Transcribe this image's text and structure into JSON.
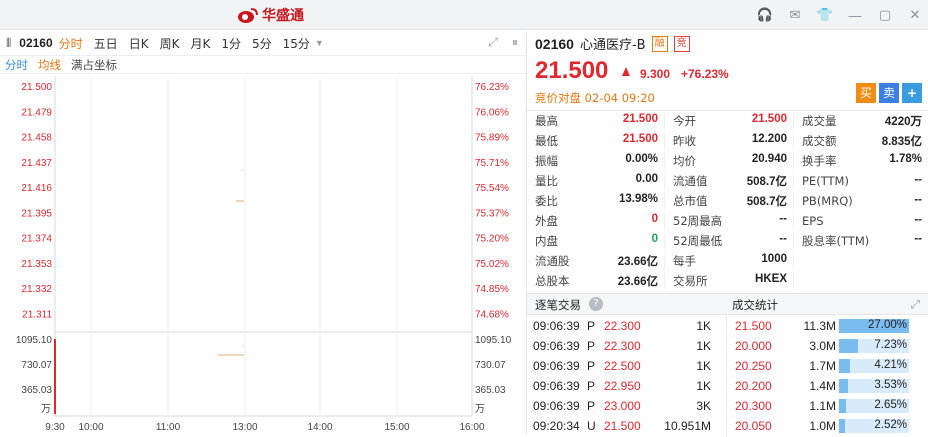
{
  "app": {
    "logo_text": "华盛通"
  },
  "toolbar": {
    "code": "02160",
    "timeframes": [
      "分时",
      "五日",
      "日K",
      "周K",
      "月K",
      "1分",
      "5分",
      "15分"
    ],
    "active_index": 0
  },
  "subtabs": {
    "tab1": "分时",
    "tab2": "均线",
    "tab3": "满占坐标"
  },
  "chart_data": {
    "type": "line",
    "price_ticks": [
      "21.500",
      "21.479",
      "21.458",
      "21.437",
      "21.416",
      "21.395",
      "21.374",
      "21.353",
      "21.332",
      "21.311"
    ],
    "pct_ticks": [
      "76.23%",
      "76.06%",
      "75.89%",
      "75.71%",
      "75.54%",
      "75.37%",
      "75.20%",
      "75.02%",
      "74.85%",
      "74.68%"
    ],
    "volume_ticks": [
      "1095.10",
      "730.07",
      "365.03"
    ],
    "volume_unit": "万",
    "x_ticks": [
      "9:30",
      "10:00",
      "11:00",
      "13:00",
      "14:00",
      "15:00",
      "16:00"
    ],
    "grid": true
  },
  "quote": {
    "code": "02160",
    "name": "心通医疗-B",
    "badge1": "融",
    "badge2": "竞",
    "price": "21.500",
    "change": "9.300",
    "change_pct": "+76.23%",
    "auction": "竞价对盘 02-04 09:20",
    "buy": "买",
    "sell": "卖",
    "add": "+"
  },
  "stats": [
    [
      [
        "最高",
        "21.500",
        "red"
      ],
      [
        "今开",
        "21.500",
        "red"
      ],
      [
        "成交量",
        "4220万",
        ""
      ]
    ],
    [
      [
        "最低",
        "21.500",
        "red"
      ],
      [
        "昨收",
        "12.200",
        ""
      ],
      [
        "成交额",
        "8.835亿",
        ""
      ]
    ],
    [
      [
        "振幅",
        "0.00%",
        ""
      ],
      [
        "均价",
        "20.940",
        ""
      ],
      [
        "换手率",
        "1.78%",
        ""
      ]
    ],
    [
      [
        "量比",
        "0.00",
        ""
      ],
      [
        "流通值",
        "508.7亿",
        ""
      ],
      [
        "PE(TTM)",
        "--",
        ""
      ]
    ],
    [
      [
        "委比",
        "13.98%",
        ""
      ],
      [
        "总市值",
        "508.7亿",
        ""
      ],
      [
        "PB(MRQ)",
        "--",
        ""
      ]
    ],
    [
      [
        "外盘",
        "0",
        "red"
      ],
      [
        "52周最高",
        "--",
        ""
      ],
      [
        "EPS",
        "--",
        ""
      ]
    ],
    [
      [
        "内盘",
        "0",
        "green"
      ],
      [
        "52周最低",
        "--",
        ""
      ],
      [
        "股息率(TTM)",
        "--",
        ""
      ]
    ],
    [
      [
        "流通股",
        "23.66亿",
        ""
      ],
      [
        "每手",
        "1000",
        ""
      ],
      [
        "",
        "",
        ""
      ]
    ],
    [
      [
        "总股本",
        "23.66亿",
        ""
      ],
      [
        "交易所",
        "HKEX",
        ""
      ],
      [
        "",
        "",
        ""
      ]
    ]
  ],
  "trades_panel": {
    "title": "逐笔交易",
    "help": "?",
    "stats_title": "成交统计"
  },
  "trades": [
    {
      "time": "09:06:39",
      "type": "P",
      "price": "22.300",
      "vol": "1K"
    },
    {
      "time": "09:06:39",
      "type": "P",
      "price": "22.300",
      "vol": "1K"
    },
    {
      "time": "09:06:39",
      "type": "P",
      "price": "22.500",
      "vol": "1K"
    },
    {
      "time": "09:06:39",
      "type": "P",
      "price": "22.950",
      "vol": "1K"
    },
    {
      "time": "09:06:39",
      "type": "P",
      "price": "23.000",
      "vol": "3K"
    },
    {
      "time": "09:20:34",
      "type": "U",
      "price": "21.500",
      "vol": "10.951M"
    }
  ],
  "trade_stats": [
    {
      "price": "21.500",
      "vol": "11.3M",
      "pct": "27.00%",
      "fill": 1.0
    },
    {
      "price": "20.000",
      "vol": "3.0M",
      "pct": "7.23%",
      "fill": 0.27
    },
    {
      "price": "20.250",
      "vol": "1.7M",
      "pct": "4.21%",
      "fill": 0.16
    },
    {
      "price": "20.200",
      "vol": "1.4M",
      "pct": "3.53%",
      "fill": 0.13
    },
    {
      "price": "20.300",
      "vol": "1.1M",
      "pct": "2.65%",
      "fill": 0.1
    },
    {
      "price": "20.050",
      "vol": "1.0M",
      "pct": "2.52%",
      "fill": 0.09
    }
  ],
  "colors": {
    "up": "#e0282e",
    "down": "#1aa34a",
    "accent": "#e8770f",
    "link": "#2f8ee0"
  }
}
